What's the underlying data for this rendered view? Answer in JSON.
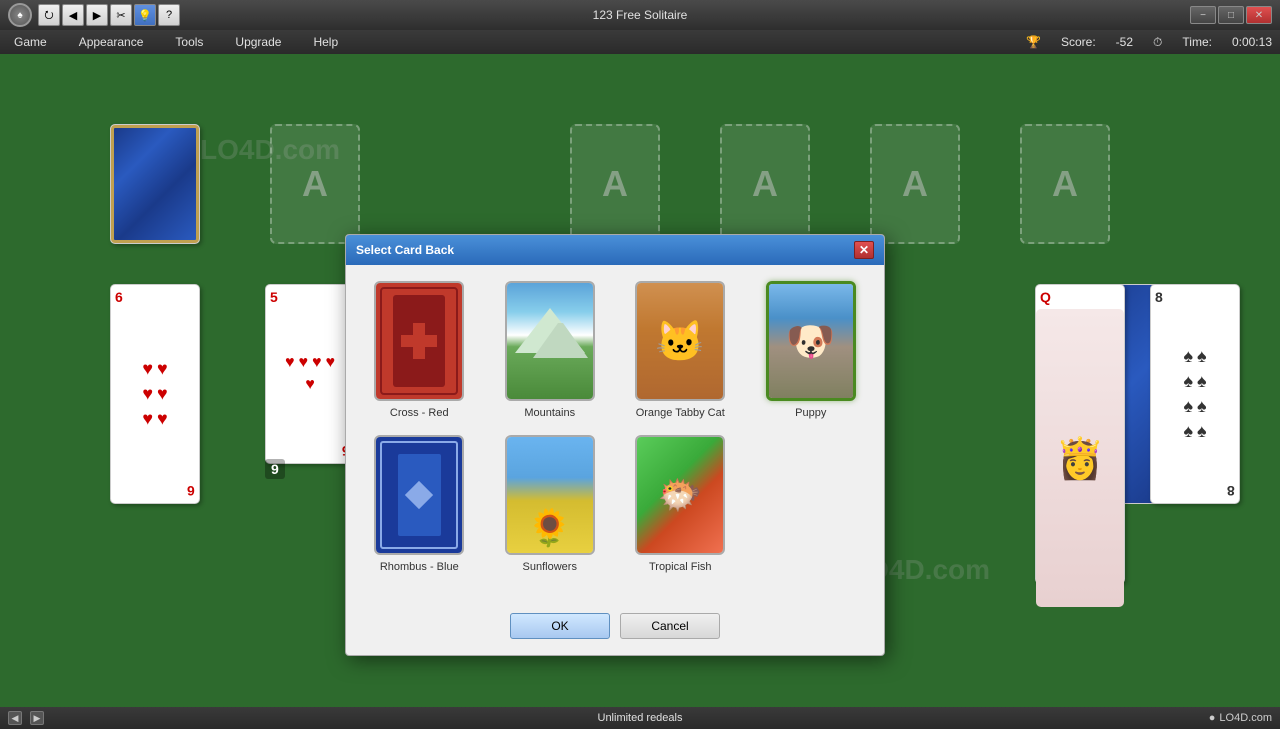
{
  "titlebar": {
    "title": "123 Free Solitaire",
    "minimize_label": "−",
    "maximize_label": "□",
    "close_label": "✕"
  },
  "menu": {
    "items": [
      "Game",
      "Appearance",
      "Tools",
      "Upgrade",
      "Help"
    ],
    "score_label": "Score:",
    "score_value": "-52",
    "time_label": "Time:",
    "time_value": "0:00:13"
  },
  "toolbar": {
    "icons": [
      "⭮",
      "◀",
      "▶",
      "✂",
      "🔵",
      "?"
    ]
  },
  "dialog": {
    "title": "Select Card Back",
    "close_label": "✕",
    "cards": [
      {
        "name": "Cross - Red",
        "type": "cross-red",
        "selected": false
      },
      {
        "name": "Mountains",
        "type": "mountains",
        "selected": false
      },
      {
        "name": "Orange Tabby Cat",
        "type": "cat",
        "selected": false
      },
      {
        "name": "Puppy",
        "type": "puppy",
        "selected": true
      },
      {
        "name": "Rhombus - Blue",
        "type": "rhombus-blue",
        "selected": false
      },
      {
        "name": "Sunflowers",
        "type": "sunflowers",
        "selected": false
      },
      {
        "name": "Tropical Fish",
        "type": "tropical",
        "selected": false
      }
    ],
    "ok_label": "OK",
    "cancel_label": "Cancel"
  },
  "status": {
    "text": "Unlimited redeals",
    "scroll_left": "◀",
    "scroll_right": "▶"
  },
  "watermarks": [
    "LO4D.com",
    "LO4D.com",
    "LO4D.com"
  ]
}
